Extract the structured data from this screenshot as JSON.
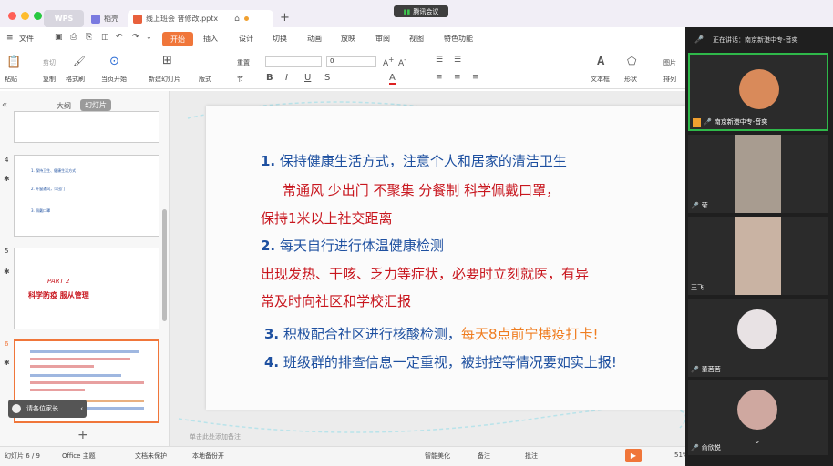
{
  "titlebar": {
    "tabs": [
      {
        "label": "WPS"
      },
      {
        "label": "稻壳"
      },
      {
        "label": "线上班会  普修改.pptx"
      }
    ],
    "new_tab": "+",
    "meeting_label": "腾讯会议"
  },
  "menu": {
    "file": "文件",
    "items": [
      "开始",
      "插入",
      "设计",
      "切换",
      "动画",
      "放映",
      "审阅",
      "视图",
      "特色功能"
    ]
  },
  "ribbon": {
    "paste": "粘贴",
    "cut": "剪切",
    "copy": "复制",
    "format_painter": "格式刷",
    "play_from_current": "当页开始",
    "new_slide": "新建幻灯片",
    "layout": "版式",
    "section": "节",
    "reset": "重置",
    "font_size": "0",
    "textbox": "文本框",
    "shape": "形状",
    "arrange": "排列",
    "picture": "图片"
  },
  "leftpanel": {
    "tab_outline": "大纲",
    "tab_slides": "幻灯片",
    "slides": [
      {
        "num": "4",
        "lines": [
          "1. 保持卫生、健康生活方式",
          "2. 开窗通风，少出门",
          "3. 佩戴口罩"
        ]
      },
      {
        "num": "5",
        "part": "PART 2",
        "title": "科学防疫  服从管理"
      },
      {
        "num": "6"
      }
    ],
    "comment_text": "请各位家长",
    "add": "+"
  },
  "slide": {
    "line1_num": "1.",
    "line1": "保持健康生活方式，注意个人和居家的清洁卫生",
    "line2": "常通风   少出门   不聚集   分餐制   科学佩戴口罩，",
    "line3": "保持1米以上社交距离",
    "line4_num": "2.",
    "line4": "每天自行进行体温健康检测",
    "line5": "出现发热、干咳、乏力等症状，必要时立刻就医，有异",
    "line6": "常及时向社区和学校汇报",
    "line7_num": "3.",
    "line7": "积极配合社区进行核酸检测，",
    "line7_orange": "每天8点前宁搏疫打卡!",
    "line8_num": "4.",
    "line8": "班级群的排查信息一定重视，被封控等情况要如实上报!"
  },
  "notes_placeholder": "单击此处添加备注",
  "status": {
    "slide_count": "幻灯片 6 / 9",
    "theme": "Office 主题",
    "doc_status": "文档未保护",
    "backup": "本地备份开",
    "smart": "智能美化",
    "notes": "备注",
    "comments": "批注",
    "zoom": "51%"
  },
  "meeting": {
    "speaking": "正在讲话：南京新港中专-音奕",
    "participants": [
      {
        "name": "南京新港中专-音奕"
      },
      {
        "name": "莹"
      },
      {
        "name": "王飞"
      },
      {
        "name": "董茜茜"
      },
      {
        "name": "俞欣悦"
      }
    ]
  },
  "colors": {
    "accent": "#f0763a",
    "slide_blue": "#1e50a0",
    "slide_red": "#c8161e",
    "slide_orange": "#ef7d20",
    "active_speaker": "#2fb84a"
  }
}
